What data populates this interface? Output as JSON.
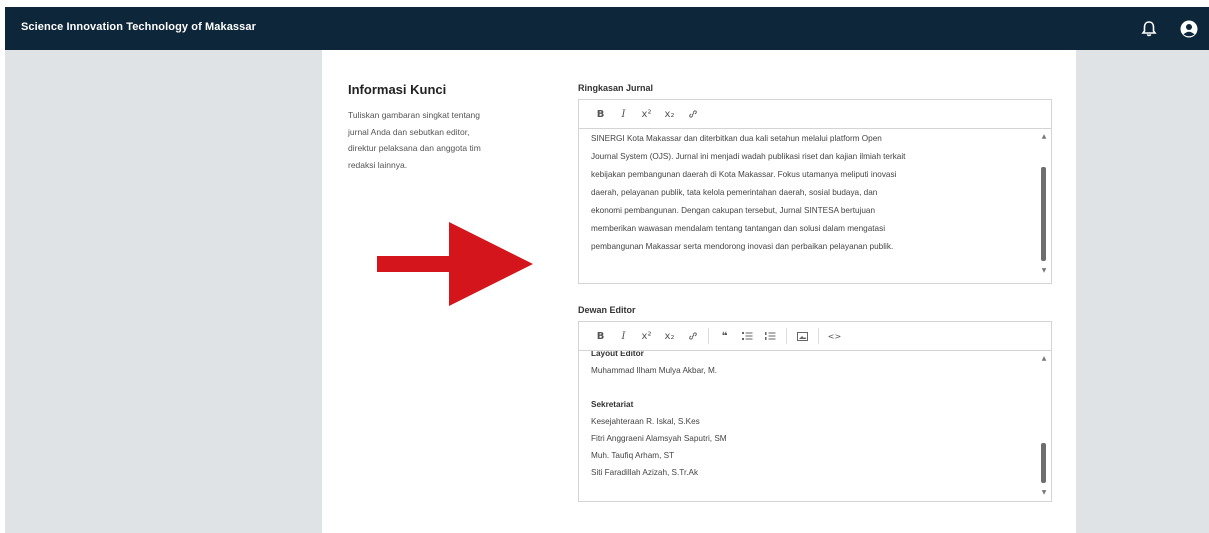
{
  "header": {
    "title": "Science Innovation Technology of Makassar",
    "icons": [
      "bell-icon",
      "user-icon"
    ]
  },
  "section": {
    "title": "Informasi Kunci",
    "description": [
      "Tuliskan gambaran singkat tentang",
      "jurnal Anda dan sebutkan editor,",
      "direktur pelaksana dan anggota tim",
      "redaksi lainnya."
    ]
  },
  "summary_field": {
    "label": "Ringkasan Jurnal",
    "toolbar": [
      "B",
      "I",
      "x²",
      "x₂",
      "link"
    ],
    "lines": [
      "SINERGI Kota Makassar dan diterbitkan dua kali setahun melalui platform Open",
      "Journal System (OJS). Jurnal ini menjadi wadah publikasi riset dan kajian ilmiah terkait",
      "kebijakan pembangunan daerah di Kota Makassar. Fokus utamanya meliputi inovasi",
      "daerah, pelayanan publik, tata kelola pemerintahan daerah, sosial budaya, dan",
      "ekonomi pembangunan. Dengan cakupan tersebut, Jurnal SINTESA bertujuan",
      "memberikan wawasan mendalam tentang tantangan dan solusi dalam mengatasi",
      "pembangunan Makassar serta mendorong inovasi dan perbaikan pelayanan publik."
    ]
  },
  "editorial_field": {
    "label": "Dewan Editor",
    "toolbar": [
      "B",
      "I",
      "x²",
      "x₂",
      "link",
      "quote",
      "bullet-list",
      "numbered-list",
      "image",
      "code"
    ],
    "layout_editor_title": "Layout Editor",
    "layout_editor_name": "Muhammad Ilham Mulya Akbar, M.",
    "secretariat_title": "Sekretariat",
    "secretariat_names": [
      "Kesejahteraan R. Iskal, S.Kes",
      "Fitri Anggraeni Alamsyah Saputri, SM",
      "Muh. Taufiq Arham, ST",
      "Siti Faradillah Azizah, S.Tr.Ak"
    ]
  }
}
